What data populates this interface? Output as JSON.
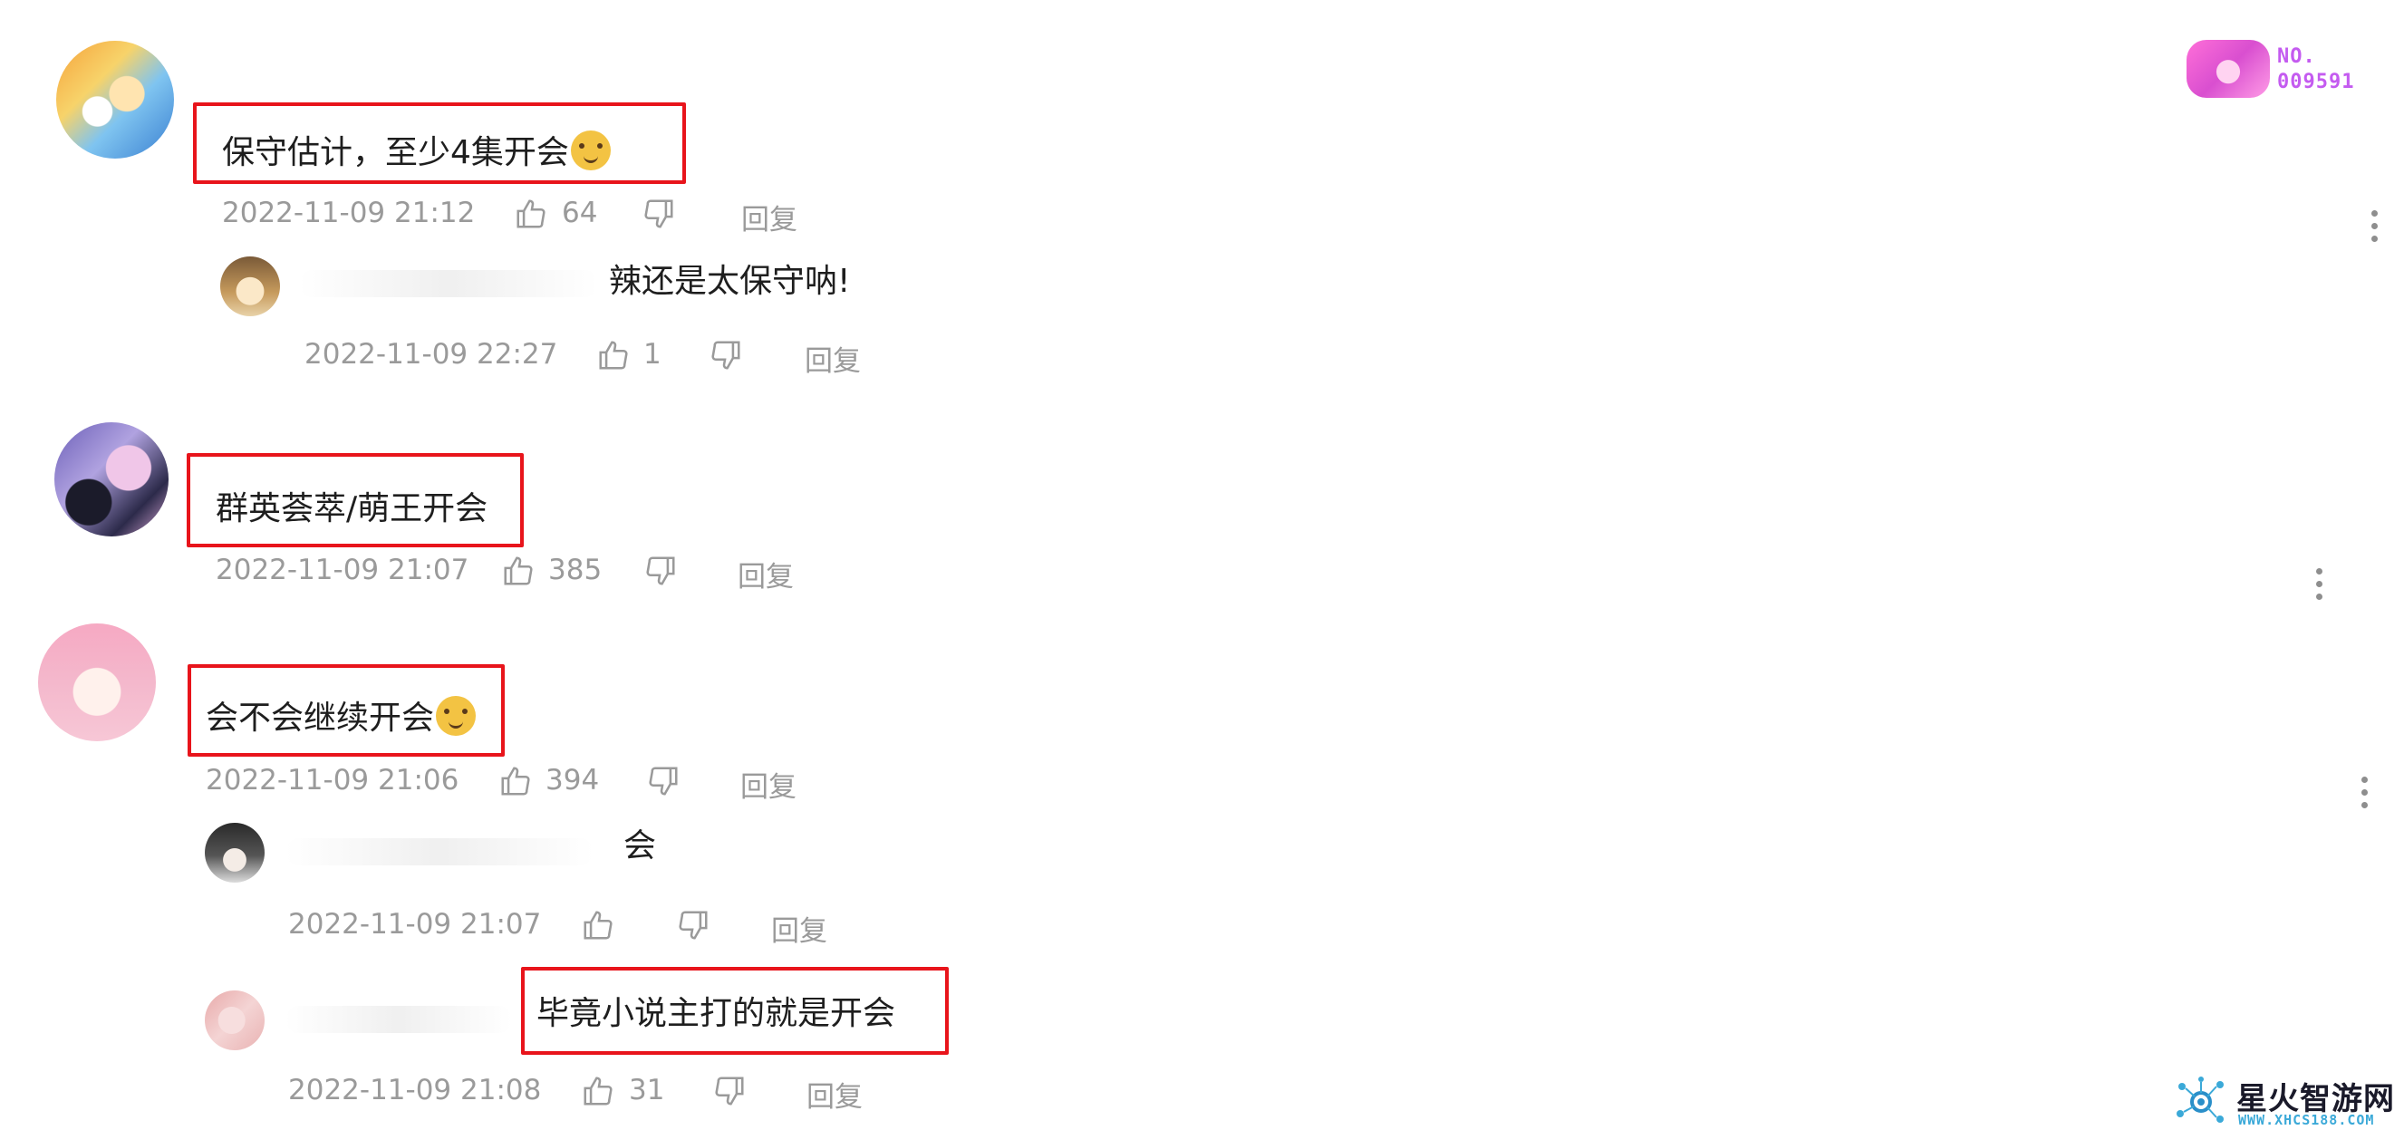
{
  "badge": {
    "line1": "NO.",
    "line2": "009591"
  },
  "watermark": {
    "name": "星火智游网",
    "url": "WWW.XHCS188.COM"
  },
  "comments": [
    {
      "text": "保守估计，至少4集开会",
      "has_emoji": true,
      "time": "2022-11-09 21:12",
      "likes": "64",
      "reply_label": "回复",
      "replies": [
        {
          "text": "辣还是太保守呐!",
          "time": "2022-11-09 22:27",
          "likes": "1",
          "reply_label": "回复"
        }
      ]
    },
    {
      "text": "群英荟萃/萌王开会",
      "time": "2022-11-09 21:07",
      "likes": "385",
      "reply_label": "回复"
    },
    {
      "text": "会不会继续开会",
      "has_emoji": true,
      "time": "2022-11-09 21:06",
      "likes": "394",
      "reply_label": "回复",
      "replies": [
        {
          "text": "会",
          "time": "2022-11-09 21:07",
          "likes": "",
          "reply_label": "回复"
        },
        {
          "text": "毕竟小说主打的就是开会",
          "time": "2022-11-09 21:08",
          "likes": "31",
          "reply_label": "回复"
        }
      ]
    }
  ]
}
